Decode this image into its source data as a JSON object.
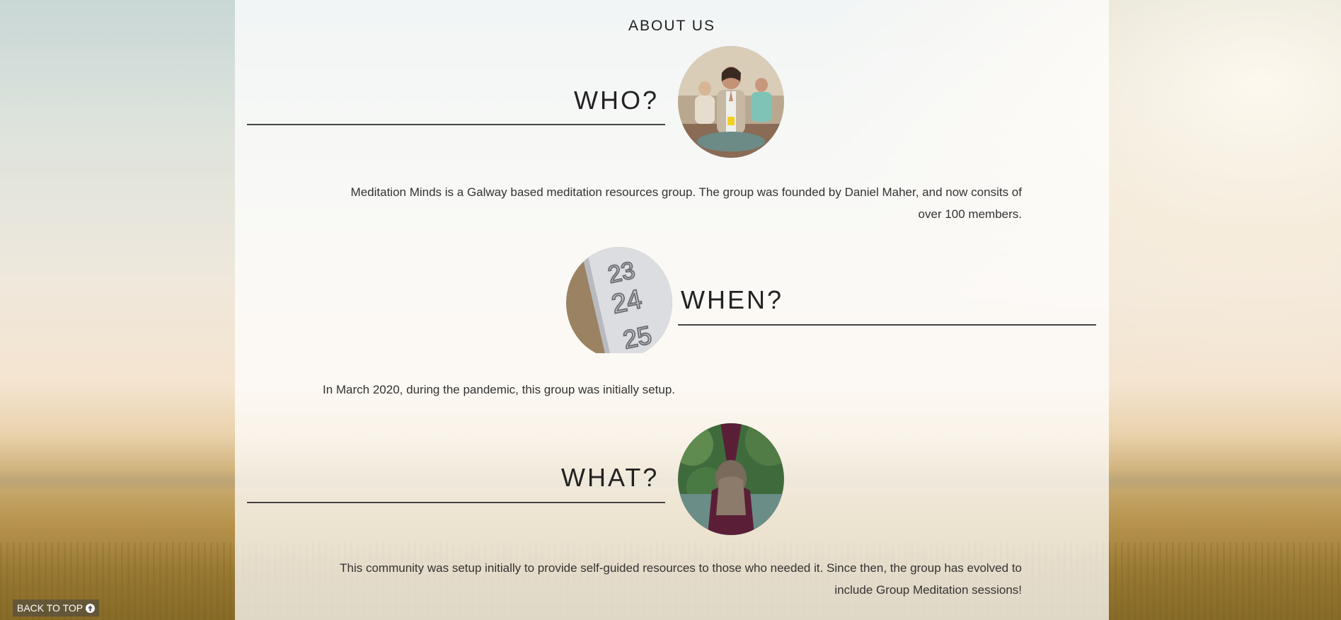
{
  "page": {
    "title": "ABOUT US"
  },
  "sections": {
    "who": {
      "heading": "WHO?",
      "image": "meditation-group-photo",
      "text": "Meditation Minds is a Galway based meditation resources group. The group was founded by Daniel Maher, and now consits of over 100 members."
    },
    "when": {
      "heading": "WHEN?",
      "image": "calendar-photo",
      "text": "In March 2020, during the pandemic, this group was initially setup."
    },
    "what": {
      "heading": "WHAT?",
      "image": "person-stretching-photo",
      "text": "This community was setup initially to provide self-guided resources to those who needed it. Since then, the group has evolved to include Group Meditation sessions!"
    }
  },
  "footer": {
    "back_to_top_label": "BACK TO TOP",
    "back_to_top_icon": "arrow-up-circle-icon"
  },
  "colors": {
    "panel": "#ffffff",
    "text": "#222222",
    "rule": "#444444"
  }
}
